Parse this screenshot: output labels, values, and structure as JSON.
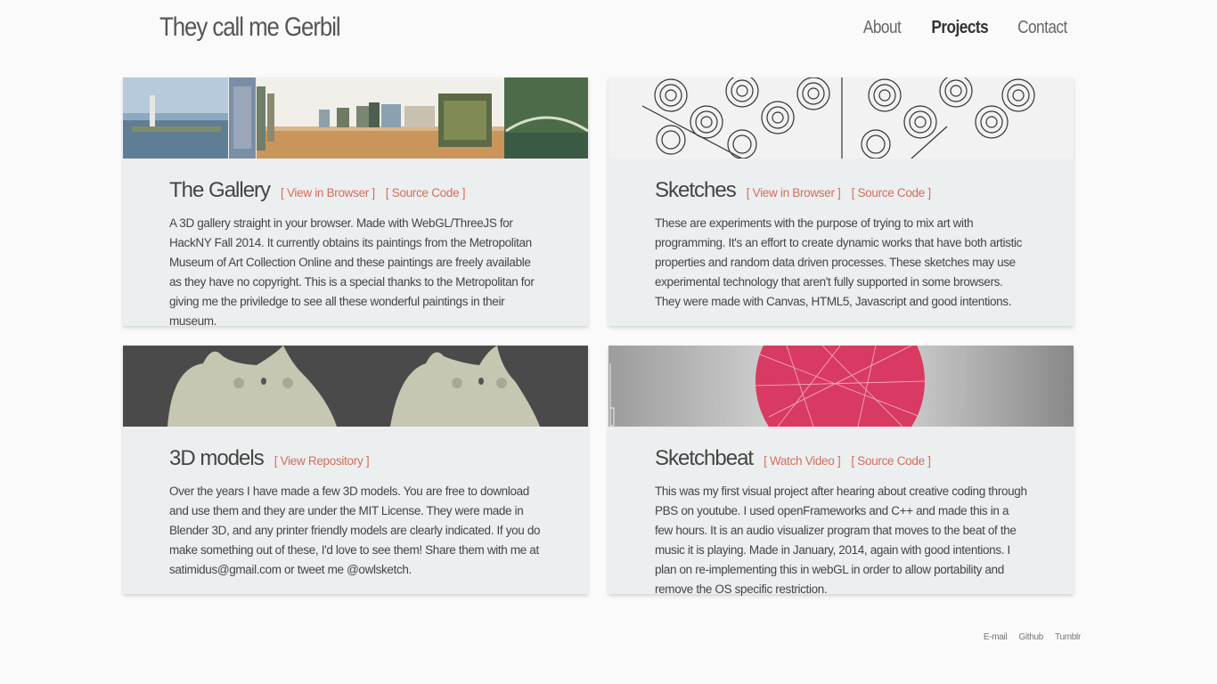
{
  "header": {
    "title": "They call me Gerbil",
    "nav": [
      {
        "label": "About"
      },
      {
        "label": "Projects",
        "active": true
      },
      {
        "label": "Contact"
      }
    ]
  },
  "projects": [
    {
      "title": "The Gallery",
      "links": [
        "[ View in Browser ]",
        "[ Source Code ]"
      ],
      "description": "A 3D gallery straight in your browser. Made with WebGL/ThreeJS for HackNY Fall 2014. It currently obtains its paintings from the Metropolitan Museum of Art Collection Online and these paintings are freely available as they have no copyright. This is a special thanks to the Metropolitan for giving me the priviledge to see all these wonderful paintings in their museum."
    },
    {
      "title": "Sketches",
      "links": [
        "[ View in Browser ]",
        "[ Source Code ]"
      ],
      "description": "These are experiments with the purpose of trying to mix art with programming. It's an effort to create dynamic works that have both artistic properties and random data driven processes. These sketches may use experimental technology that aren't fully supported in some browsers. They were made with Canvas, HTML5, Javascript and good intentions."
    },
    {
      "title": "3D models",
      "links": [
        "[ View Repository ]"
      ],
      "description": "Over the years I have made a few 3D models. You are free to download and use them and they are under the MIT License. They were made in Blender 3D, and any printer friendly models are clearly indicated. If you do make something out of these, I'd love to see them! Share them with me at satimidus@gmail.com or tweet me @owlsketch."
    },
    {
      "title": "Sketchbeat",
      "links": [
        "[ Watch Video ]",
        "[ Source Code ]"
      ],
      "description": "This was my first visual project after hearing about creative coding through PBS on youtube. I used openFrameworks and C++ and made this in a few hours. It is an audio visualizer program that moves to the beat of the music it is playing. Made in January, 2014, again with good intentions. I plan on re-implementing this in webGL in order to allow portability and remove the OS specific restriction."
    }
  ],
  "footer": {
    "links": [
      "E-mail",
      "Github",
      "Tumblr"
    ]
  },
  "colors": {
    "accent": "#d66c5a",
    "card_bg": "#eceff0",
    "page_bg": "#fafafa",
    "sketchbeat_sphere": "#d83a63"
  }
}
